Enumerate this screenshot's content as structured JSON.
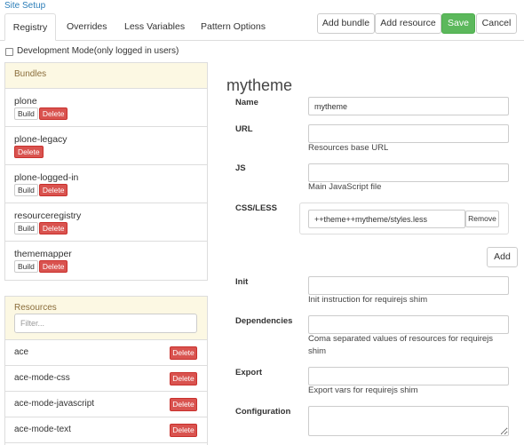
{
  "header": {
    "site_setup": "Site Setup"
  },
  "tabs": [
    {
      "label": "Registry",
      "active": true
    },
    {
      "label": "Overrides",
      "active": false
    },
    {
      "label": "Less Variables",
      "active": false
    },
    {
      "label": "Pattern Options",
      "active": false
    }
  ],
  "toolbar": {
    "add_bundle": "Add bundle",
    "add_resource": "Add resource",
    "save": "Save",
    "cancel": "Cancel"
  },
  "dev_mode": {
    "label": "Development Mode(only logged in users)",
    "checked": false
  },
  "bundles": {
    "title": "Bundles",
    "items": [
      {
        "name": "plone",
        "build": "Build",
        "delete": "Delete"
      },
      {
        "name": "plone-legacy",
        "delete": "Delete"
      },
      {
        "name": "plone-logged-in",
        "build": "Build",
        "delete": "Delete"
      },
      {
        "name": "resourceregistry",
        "build": "Build",
        "delete": "Delete"
      },
      {
        "name": "thememapper",
        "build": "Build",
        "delete": "Delete"
      }
    ]
  },
  "resources": {
    "title": "Resources",
    "filter_placeholder": "Filter...",
    "items": [
      {
        "name": "ace",
        "delete": "Delete"
      },
      {
        "name": "ace-mode-css",
        "delete": "Delete"
      },
      {
        "name": "ace-mode-javascript",
        "delete": "Delete"
      },
      {
        "name": "ace-mode-text",
        "delete": "Delete"
      }
    ]
  },
  "form": {
    "title": "mytheme",
    "add_label": "Add",
    "fields": {
      "name": {
        "label": "Name",
        "value": "mytheme"
      },
      "url": {
        "label": "URL",
        "help": "Resources base URL"
      },
      "js": {
        "label": "JS",
        "help": "Main JavaScript file"
      },
      "css": {
        "label": "CSS/LESS",
        "values": [
          "++theme++mytheme/styles.less"
        ],
        "remove_label": "Remove"
      },
      "init": {
        "label": "Init",
        "help": "Init instruction for requirejs shim"
      },
      "deps": {
        "label": "Dependencies",
        "help": "Coma separated values of resources for requirejs shim"
      },
      "export": {
        "label": "Export",
        "help": "Export vars for requirejs shim"
      },
      "conf": {
        "label": "Configuration"
      }
    }
  },
  "colors": {
    "link": "#2b7db8",
    "save": "#5cb85c",
    "delete": "#d9534f",
    "panel-header": "#fcf8e3"
  }
}
